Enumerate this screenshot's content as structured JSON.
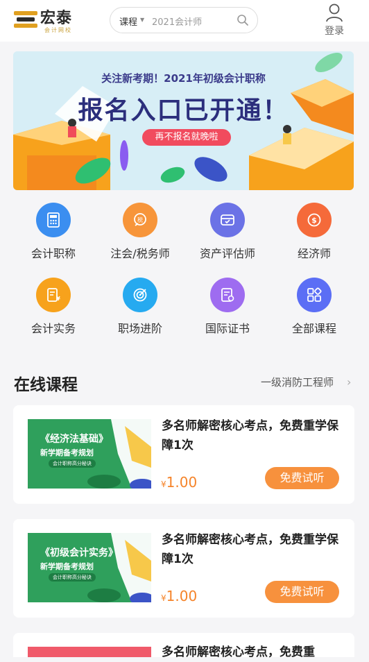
{
  "header": {
    "logo_name": "宏泰",
    "logo_sub": "会计网校",
    "search_category": "课程",
    "search_placeholder": "2021会计师",
    "login_label": "登录"
  },
  "banner": {
    "line1": "关注新考期！2021年初级会计职称",
    "line2": "报名入口已开通！",
    "pill": "再不报名就晚啦"
  },
  "categories": [
    {
      "label": "会计职称",
      "icon": "calculator-icon",
      "color": "#3b8ef0"
    },
    {
      "label": "注会/税务师",
      "icon": "tax-icon",
      "color": "#f7953a"
    },
    {
      "label": "资产评估师",
      "icon": "wallet-icon",
      "color": "#6b72e6"
    },
    {
      "label": "经济师",
      "icon": "coin-icon",
      "color": "#f56a3a"
    },
    {
      "label": "会计实务",
      "icon": "document-icon",
      "color": "#f7a21c"
    },
    {
      "label": "职场进阶",
      "icon": "target-icon",
      "color": "#26aaf0"
    },
    {
      "label": "国际证书",
      "icon": "certificate-icon",
      "color": "#9e6cf0"
    },
    {
      "label": "全部课程",
      "icon": "grid-icon",
      "color": "#5b6ef5"
    }
  ],
  "section": {
    "title": "在线课程",
    "more": "一级消防工程师"
  },
  "courses": [
    {
      "thumb_title": "《经济法基础》",
      "thumb_sub": "新学期备考规划",
      "thumb_tag": "会计职称高分秘诀",
      "title": "多名师解密核心考点，免费重学保障1次",
      "currency": "¥",
      "price": "1.00",
      "button": "免费试听"
    },
    {
      "thumb_title": "《初级会计实务》",
      "thumb_sub": "新学期备考规划",
      "thumb_tag": "会计职称高分秘诀",
      "title": "多名师解密核心考点，免费重学保障1次",
      "currency": "¥",
      "price": "1.00",
      "button": "免费试听"
    },
    {
      "title": "多名师解密核心考点，免费重"
    }
  ]
}
